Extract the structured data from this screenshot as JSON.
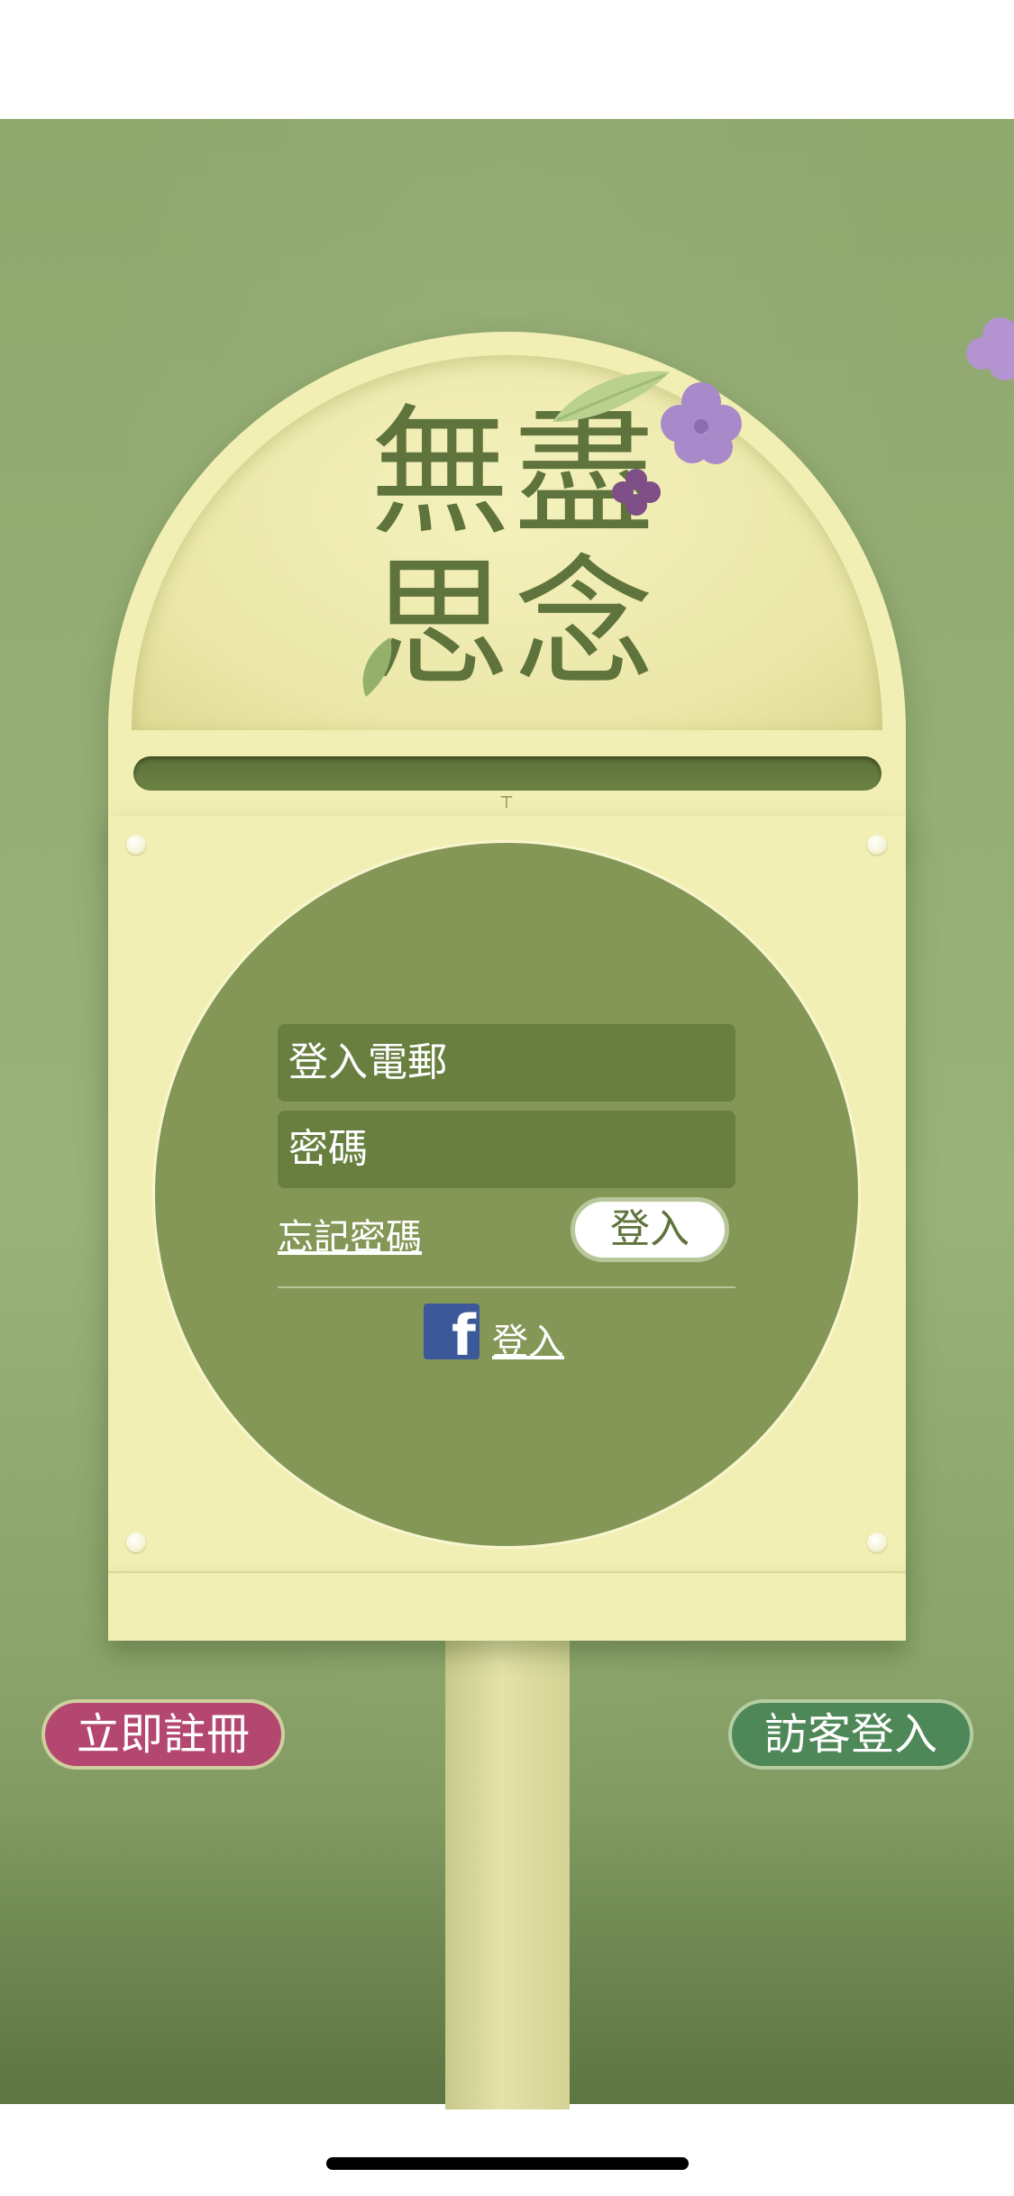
{
  "title": {
    "line1": "無盡",
    "line2": "思念"
  },
  "form": {
    "email_placeholder": "登入電郵",
    "password_placeholder": "密碼",
    "forgot_password": "忘記密碼",
    "login_button": "登入",
    "facebook_login": "登入"
  },
  "actions": {
    "register": "立即註冊",
    "guest_login": "訪客登入"
  },
  "icons": {
    "facebook": "facebook-icon",
    "flower": "flower-icon",
    "leaf": "leaf-icon"
  },
  "colors": {
    "background": "#93ab72",
    "mailbox": "#f2efb4",
    "circle": "#849756",
    "field": "#697f40",
    "title": "#5f733c",
    "register": "#b4476f",
    "guest": "#4e8758",
    "facebook": "#3b5998",
    "flower": "#a889c9"
  }
}
